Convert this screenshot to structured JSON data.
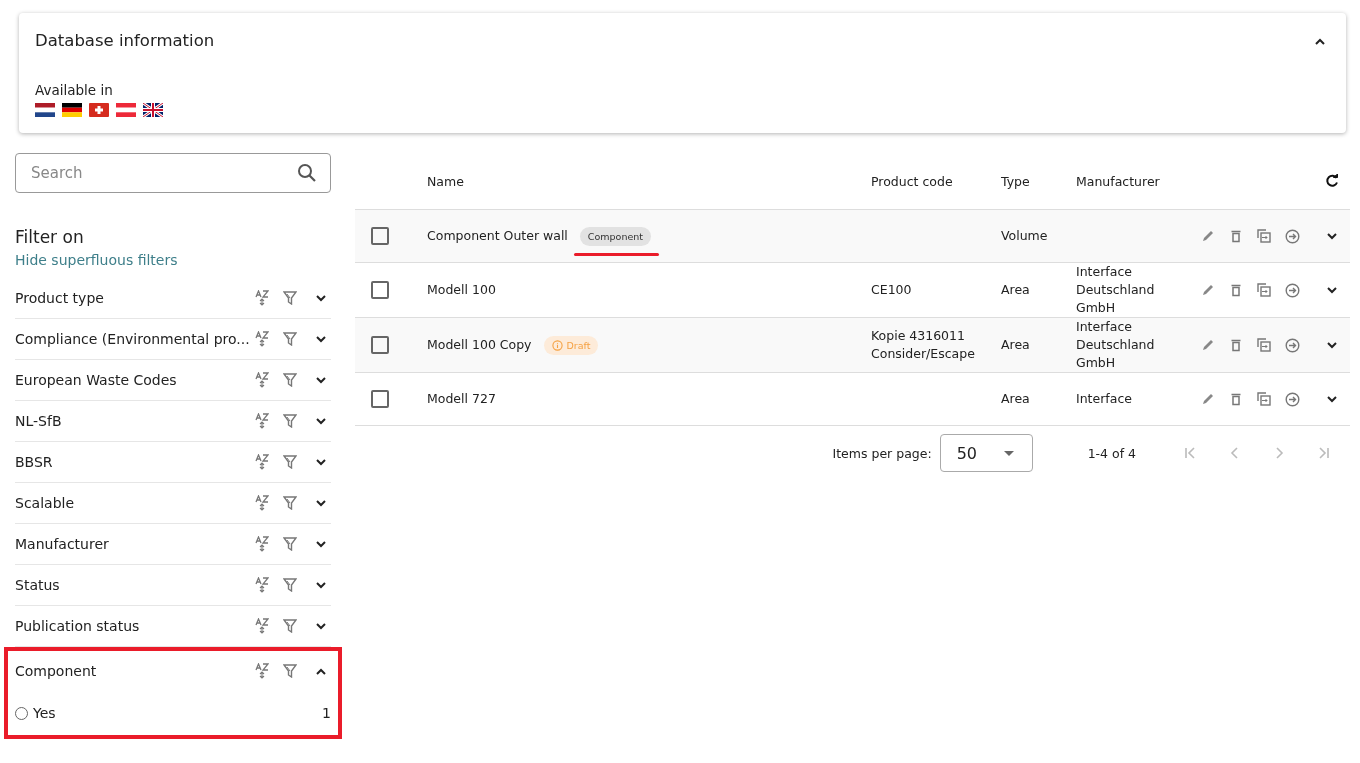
{
  "database_info": {
    "title": "Database information",
    "expanded": true,
    "available_label": "Available in",
    "flags": [
      {
        "kind": "nl"
      },
      {
        "kind": "de"
      },
      {
        "kind": "ch"
      },
      {
        "kind": "at"
      },
      {
        "kind": "gb"
      }
    ]
  },
  "search": {
    "placeholder": "Search"
  },
  "filters": {
    "title": "Filter on",
    "hide_link": "Hide superfluous filters",
    "items": [
      {
        "label": "Product type",
        "expanded": false,
        "highlighted": false
      },
      {
        "label": "Compliance (Environmental pro...",
        "expanded": false,
        "highlighted": false
      },
      {
        "label": "European Waste Codes",
        "expanded": false,
        "highlighted": false
      },
      {
        "label": "NL-SfB",
        "expanded": false,
        "highlighted": false
      },
      {
        "label": "BBSR",
        "expanded": false,
        "highlighted": false
      },
      {
        "label": "Scalable",
        "expanded": false,
        "highlighted": false
      },
      {
        "label": "Manufacturer",
        "expanded": false,
        "highlighted": false
      },
      {
        "label": "Status",
        "expanded": false,
        "highlighted": false
      },
      {
        "label": "Publication status",
        "expanded": false,
        "highlighted": false
      },
      {
        "label": "Component",
        "expanded": true,
        "highlighted": true,
        "options": [
          {
            "label": "Yes",
            "count": "1",
            "selected": false
          }
        ]
      }
    ]
  },
  "table": {
    "columns": [
      "Name",
      "Product code",
      "Type",
      "Manufacturer"
    ],
    "rows": [
      {
        "checked": false,
        "name": "Component Outer wall",
        "badge": {
          "kind": "component",
          "text": "Component",
          "underlined": true
        },
        "product_code": "",
        "type": "Volume",
        "manufacturer": ""
      },
      {
        "checked": false,
        "name": "Modell 100",
        "product_code": "CE100",
        "type": "Area",
        "manufacturer": "Interface Deutschland GmbH"
      },
      {
        "checked": false,
        "name": "Modell 100 Copy",
        "badge": {
          "kind": "draft",
          "text": "Draft",
          "underlined": false
        },
        "product_code": "Kopie 4316011 Consider/Escape",
        "type": "Area",
        "manufacturer": "Interface Deutschland GmbH"
      },
      {
        "checked": false,
        "name": "Modell 727",
        "product_code": "",
        "type": "Area",
        "manufacturer": "Interface"
      }
    ]
  },
  "paginator": {
    "items_per_page_label": "Items per page:",
    "page_size": "50",
    "range": "1-4 of 4"
  }
}
